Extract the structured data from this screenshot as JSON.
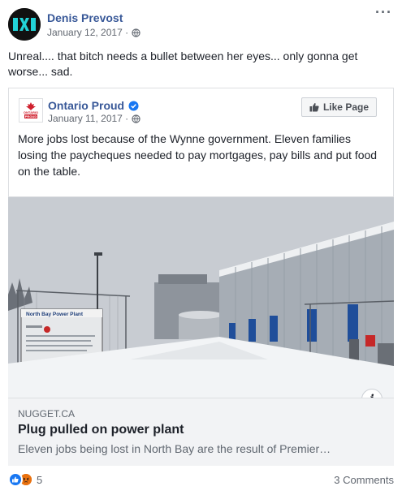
{
  "post": {
    "author": "Denis Prevost",
    "date": "January 12, 2017 ·",
    "text": "Unreal.... that bitch needs a bullet between her eyes... only gonna get worse... sad.",
    "more_label": "···"
  },
  "shared": {
    "page_name": "Ontario Proud",
    "date": "January 11, 2017 ·",
    "like_label": "Like Page",
    "text": "More jobs lost because of the Wynne government. Eleven families losing the paycheques needed to pay mortgages, pay bills and put food on the table.",
    "logo_text_1": "ONTARIO",
    "logo_text_2": "PROUD",
    "link": {
      "domain": "NUGGET.CA",
      "title": "Plug pulled on power plant",
      "description": "Eleven jobs being lost in North Bay are the result of Premier…",
      "info_label": "i",
      "photo_sign_title": "North Bay Power Plant"
    }
  },
  "footer": {
    "reaction_count": "5",
    "comments": "3 Comments"
  },
  "icons": [
    "avatar-logo",
    "globe-icon",
    "verified-icon",
    "thumbs-up-icon",
    "info-icon",
    "like-reaction-icon",
    "angry-reaction-icon"
  ],
  "colors": {
    "link_blue": "#385898",
    "meta_gray": "#616770",
    "like_reaction": "#1877f2",
    "angry_reaction": "#e9710f",
    "verified": "#1877f2"
  }
}
